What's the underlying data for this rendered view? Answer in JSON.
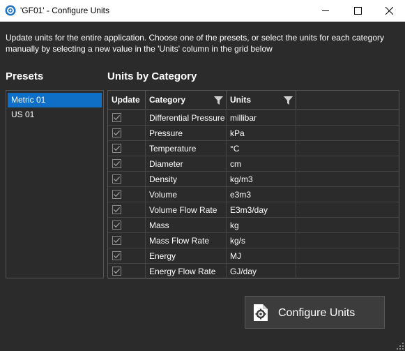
{
  "window": {
    "title": "'GF01' - Configure Units"
  },
  "description": "Update units for the entire application. Choose one of the presets, or select the units for each category manually by selecting a new value in the 'Units' column in the grid below",
  "presets": {
    "heading": "Presets",
    "items": [
      {
        "label": "Metric 01",
        "selected": true
      },
      {
        "label": "US 01",
        "selected": false
      }
    ]
  },
  "units_grid": {
    "heading": "Units by Category",
    "columns": {
      "update": "Update",
      "category": "Category",
      "units": "Units"
    },
    "rows": [
      {
        "update": true,
        "category": "Differential Pressure",
        "units": "millibar"
      },
      {
        "update": true,
        "category": "Pressure",
        "units": "kPa"
      },
      {
        "update": true,
        "category": "Temperature",
        "units": "°C"
      },
      {
        "update": true,
        "category": "Diameter",
        "units": "cm"
      },
      {
        "update": true,
        "category": "Density",
        "units": "kg/m3"
      },
      {
        "update": true,
        "category": "Volume",
        "units": "e3m3"
      },
      {
        "update": true,
        "category": "Volume Flow Rate",
        "units": "E3m3/day"
      },
      {
        "update": true,
        "category": "Mass",
        "units": "kg"
      },
      {
        "update": true,
        "category": "Mass Flow Rate",
        "units": "kg/s"
      },
      {
        "update": true,
        "category": "Energy",
        "units": "MJ"
      },
      {
        "update": true,
        "category": "Energy Flow Rate",
        "units": "GJ/day"
      }
    ]
  },
  "configure_button": {
    "label": "Configure Units",
    "icon": "gear-document-icon"
  },
  "colors": {
    "background": "#2b2b2b",
    "selection": "#0f6fc6",
    "text": "#ffffff"
  }
}
